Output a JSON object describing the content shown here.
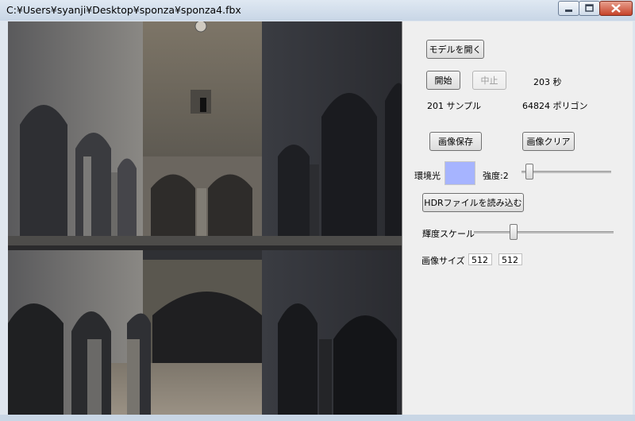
{
  "window": {
    "title": "C:¥Users¥syanji¥Desktop¥sponza¥sponza4.fbx"
  },
  "panel": {
    "open_model": "モデルを開く",
    "start": "開始",
    "stop": "中止",
    "seconds": "203 秒",
    "samples": "201 サンプル",
    "polygons": "64824 ポリゴン",
    "save_image": "画像保存",
    "clear_image": "画像クリア",
    "ambient_label": "環境光",
    "ambient_color": "#a6b4ff",
    "intensity_label": "強度:2",
    "intensity_slider_level": 0.05,
    "load_hdr": "HDRファイルを読み込む",
    "luminance_label": "輝度スケール",
    "luminance_slider_level": 0.27,
    "image_size_label": "画像サイズ",
    "image_width": "512",
    "image_height": "512"
  }
}
